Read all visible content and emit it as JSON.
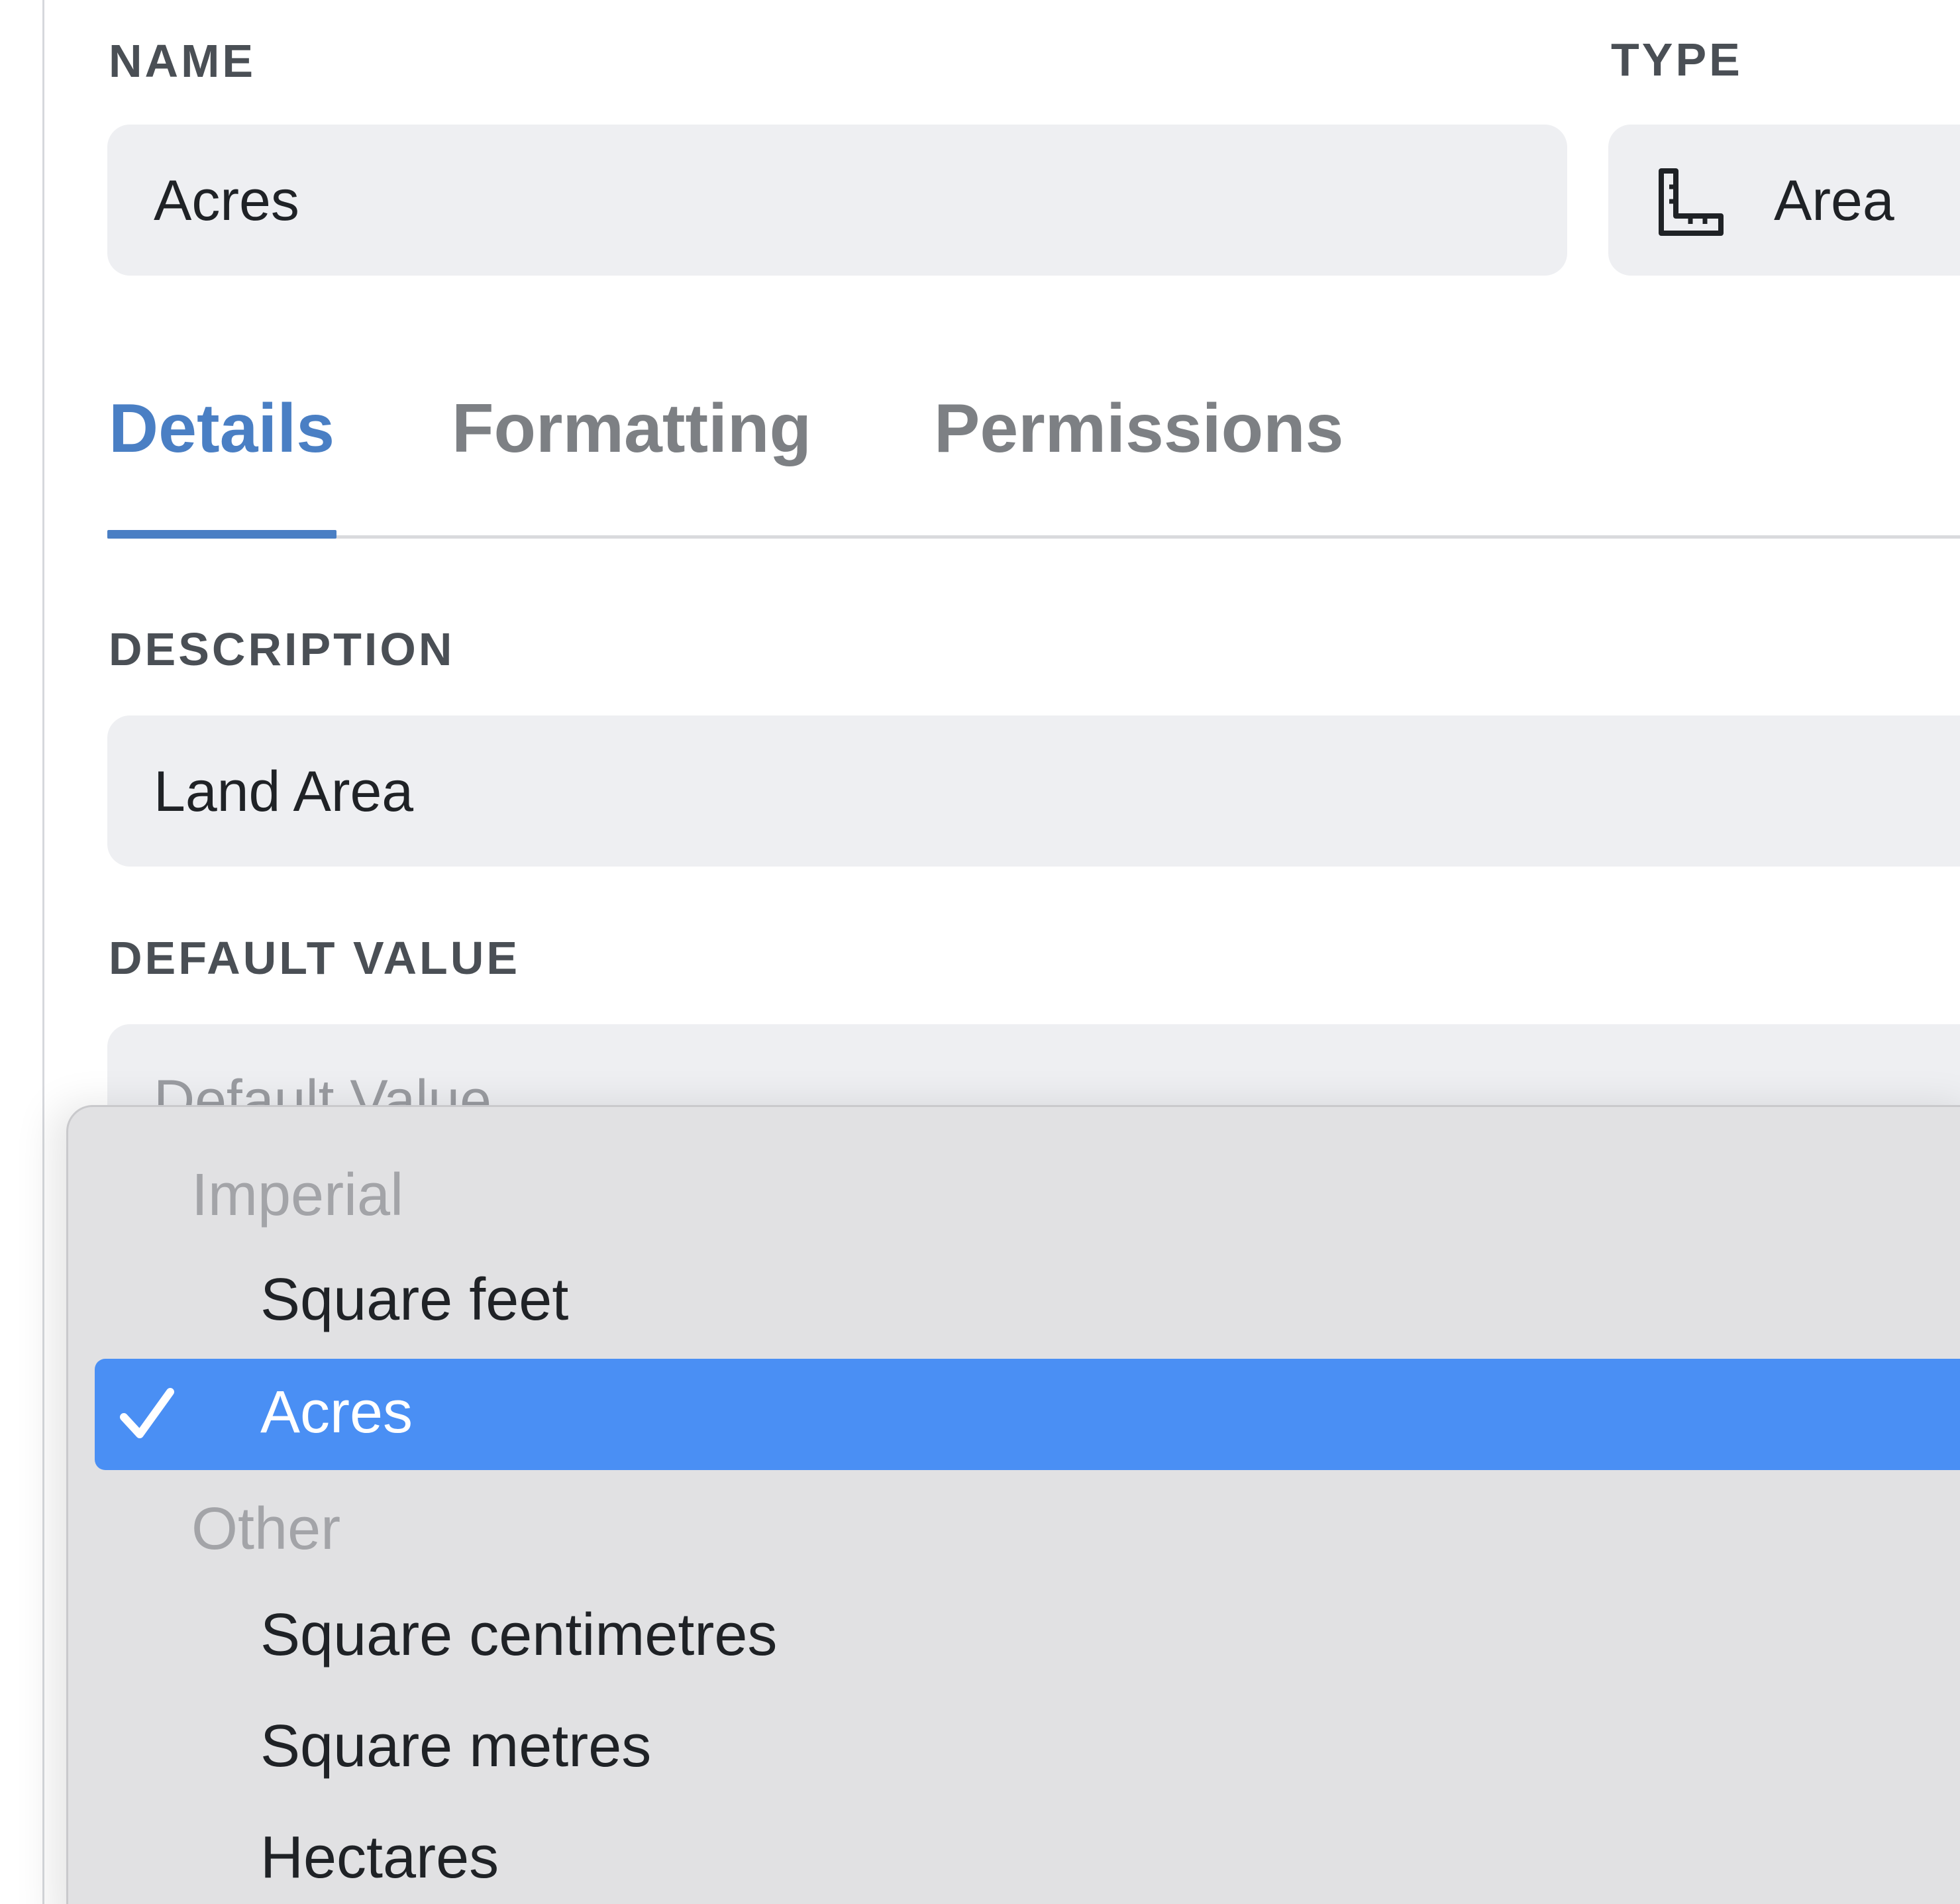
{
  "fields": {
    "name_label": "NAME",
    "name_value": "Acres",
    "type_label": "TYPE",
    "type_value": "Area",
    "type_icon": "ruler-icon",
    "description_label": "DESCRIPTION",
    "description_value": "Land Area",
    "default_label": "DEFAULT VALUE",
    "default_placeholder": "Default Value"
  },
  "tabs": [
    {
      "label": "Details",
      "active": true
    },
    {
      "label": "Formatting",
      "active": false
    },
    {
      "label": "Permissions",
      "active": false
    }
  ],
  "dropdown": {
    "groups": [
      {
        "label": "Imperial",
        "options": [
          {
            "label": "Square feet",
            "selected": false
          },
          {
            "label": "Acres",
            "selected": true
          }
        ]
      },
      {
        "label": "Other",
        "options": [
          {
            "label": "Square centimetres",
            "selected": false
          },
          {
            "label": "Square metres",
            "selected": false
          },
          {
            "label": "Hectares",
            "selected": false
          }
        ]
      }
    ],
    "check_icon": "checkmark-icon"
  },
  "colors": {
    "accent": "#4a7fc4",
    "selected_bg": "#4a8ff4",
    "input_bg": "#eeeff2",
    "dropdown_bg": "#e1e1e3"
  }
}
